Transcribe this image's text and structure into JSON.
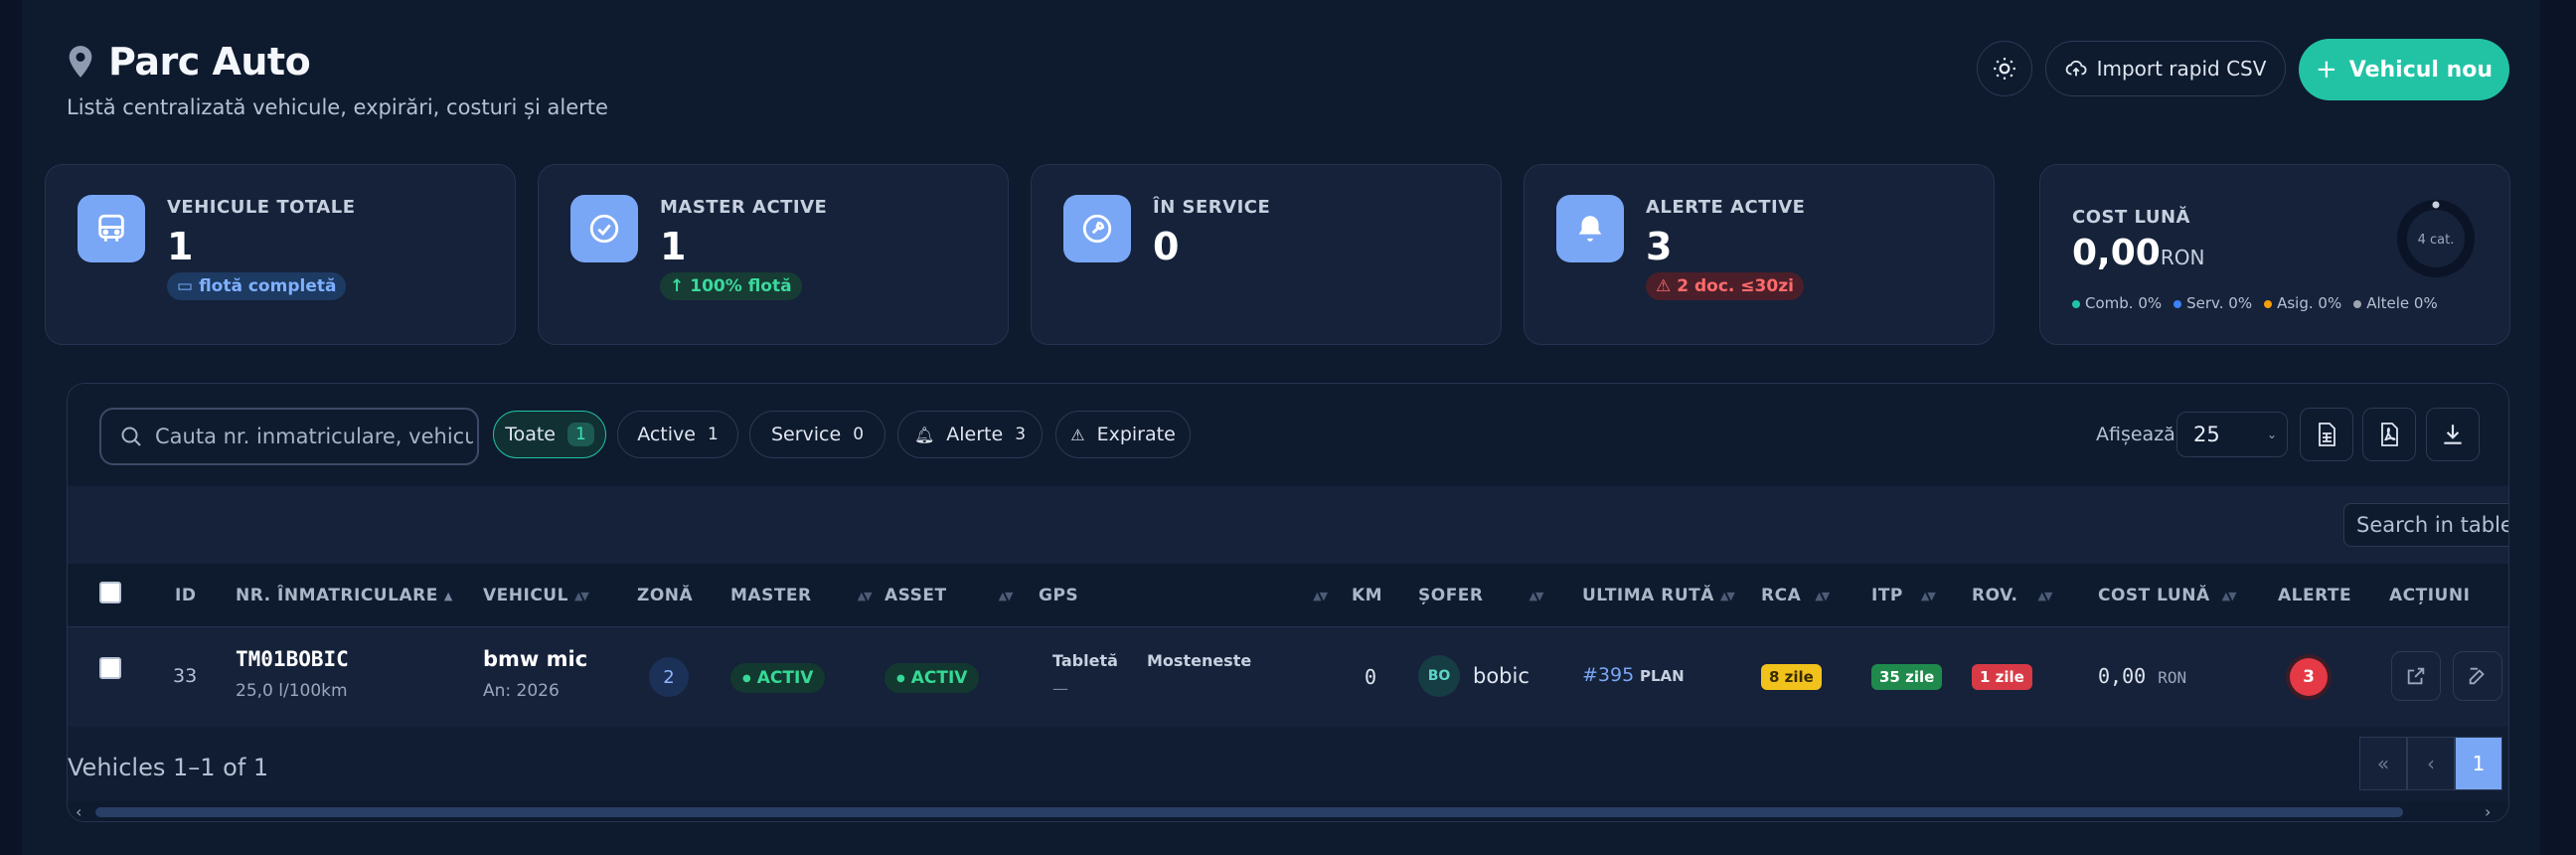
{
  "header": {
    "title": "Parc Auto",
    "subtitle": "Listă centralizată vehicule, expirări, costuri și alerte",
    "import_label": "Import rapid CSV",
    "new_label": "Vehicul nou"
  },
  "stats": [
    {
      "label": "VEHICULE TOTALE",
      "value": "1",
      "chip": "flotă completă",
      "icon": "bus-icon"
    },
    {
      "label": "MASTER ACTIVE",
      "value": "1",
      "chip": "100% flotă",
      "icon": "check-circle-icon"
    },
    {
      "label": "ÎN SERVICE",
      "value": "0",
      "icon": "wrench-icon"
    },
    {
      "label": "ALERTE ACTIVE",
      "value": "3",
      "chip": "2 doc. ≤30zi",
      "icon": "bell-icon"
    }
  ],
  "cost": {
    "label": "COST LUNĂ",
    "value": "0,00",
    "unit": "RON",
    "donut_label": "4 cat.",
    "legend": [
      {
        "label": "Comb. 0%",
        "color": "#22c3a5"
      },
      {
        "label": "Serv. 0%",
        "color": "#3b82f6"
      },
      {
        "label": "Asig. 0%",
        "color": "#f59e0b"
      },
      {
        "label": "Altele 0%",
        "color": "#9ca3af"
      }
    ]
  },
  "toolbar": {
    "search_placeholder": "Cauta nr. inmatriculare, vehicul...",
    "filters": [
      {
        "label": "Toate",
        "count": "1"
      },
      {
        "label": "Active",
        "count": "1"
      },
      {
        "label": "Service",
        "count": "0"
      },
      {
        "label": "Alerte",
        "count": "3"
      },
      {
        "label": "Expirate"
      }
    ],
    "show_label": "Afișează",
    "page_size": "25"
  },
  "table": {
    "search_placeholder": "Search in table",
    "columns": [
      "ID",
      "NR. ÎNMATRICULARE",
      "VEHICUL",
      "ZONĂ",
      "MASTER",
      "ASSET",
      "GPS",
      "KM",
      "ȘOFER",
      "ULTIMA RUTĂ",
      "RCA",
      "ITP",
      "ROV.",
      "COST LUNĂ",
      "ALERTE",
      "ACȚIUNI"
    ],
    "row": {
      "id": "33",
      "plate": "TM01BOBIC",
      "consumption": "25,0 l/100km",
      "vehicle": "bmw mic",
      "year": "An: 2026",
      "zone": "2",
      "master": "ACTIV",
      "asset": "ACTIV",
      "gps_device": "Tabletă",
      "gps_dash": "—",
      "gps_mode": "Mosteneste",
      "km": "0",
      "driver_initials": "BO",
      "driver": "bobic",
      "route_id": "#395",
      "route_status": "PLAN",
      "rca": "8 zile",
      "itp": "35 zile",
      "rov": "1 zile",
      "cost": "0,00",
      "cost_unit": "RON",
      "alerts": "3"
    },
    "footer": "Vehicles 1–1 of 1",
    "pager": [
      "«",
      "‹",
      "1"
    ]
  }
}
